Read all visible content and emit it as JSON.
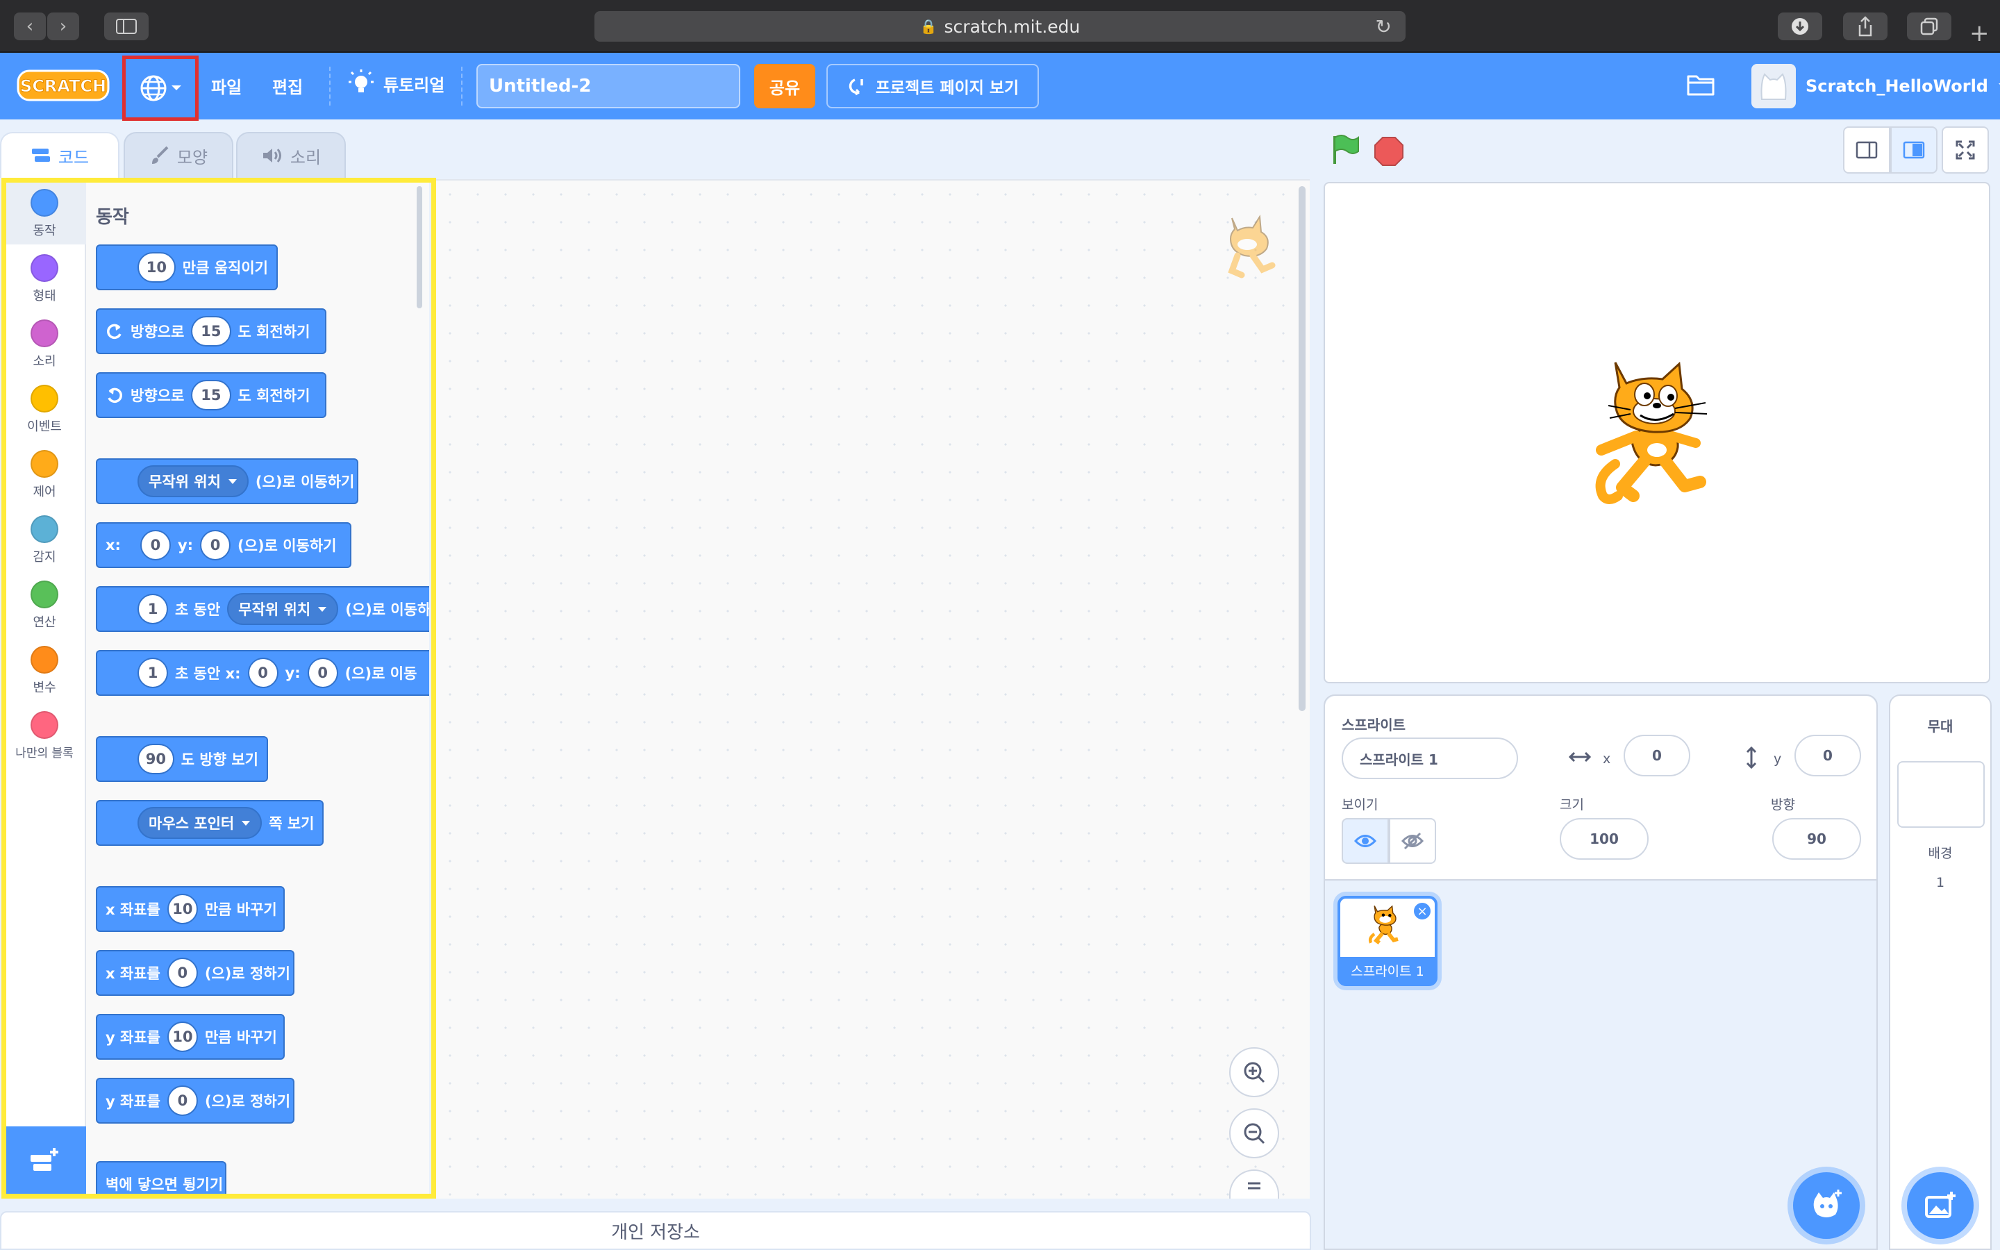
{
  "browser": {
    "url": "scratch.mit.edu"
  },
  "menubar": {
    "file": "파일",
    "edit": "편집",
    "tutorials": "튜토리얼",
    "project_title": "Untitled-2",
    "share": "공유",
    "see_project_page": "프로젝트 페이지 보기",
    "username": "Scratch_HelloWorld",
    "logo_text": "SCRATCH"
  },
  "tabs": {
    "code": "코드",
    "costumes": "모양",
    "sounds": "소리"
  },
  "categories": [
    {
      "label": "동작",
      "color": "#4c97ff"
    },
    {
      "label": "형태",
      "color": "#9966ff"
    },
    {
      "label": "소리",
      "color": "#cf63cf"
    },
    {
      "label": "이벤트",
      "color": "#ffbf00"
    },
    {
      "label": "제어",
      "color": "#ffab19"
    },
    {
      "label": "감지",
      "color": "#5cb1d6"
    },
    {
      "label": "연산",
      "color": "#59c059"
    },
    {
      "label": "변수",
      "color": "#ff8c1a"
    },
    {
      "label": "나만의 블록",
      "color": "#ff6680"
    }
  ],
  "palette": {
    "section_title": "동작",
    "blocks": {
      "move": {
        "value": "10",
        "text": "만큼 움직이기"
      },
      "turn_right": {
        "pre": "방향으로",
        "value": "15",
        "text": "도 회전하기"
      },
      "turn_left": {
        "pre": "방향으로",
        "value": "15",
        "text": "도 회전하기"
      },
      "goto": {
        "dropdown": "무작위 위치",
        "text": "(으)로 이동하기"
      },
      "goto_xy": {
        "x_label": "x:",
        "x": "0",
        "y_label": "y:",
        "y": "0",
        "text": "(으)로 이동하기"
      },
      "glide": {
        "value": "1",
        "mid": "초 동안",
        "dropdown": "무작위 위치",
        "text": "(으)로 이동하"
      },
      "glide_xy": {
        "value": "1",
        "mid": "초 동안 x:",
        "x": "0",
        "y_label": "y:",
        "y": "0",
        "text": "(으)로 이동"
      },
      "point_dir": {
        "value": "90",
        "text": "도 방향 보기"
      },
      "point_towards": {
        "dropdown": "마우스 포인터",
        "text": "쪽 보기"
      },
      "change_x": {
        "pre": "x 좌표를",
        "value": "10",
        "text": "만큼 바꾸기"
      },
      "set_x": {
        "pre": "x 좌표를",
        "value": "0",
        "text": "(으)로 정하기"
      },
      "change_y": {
        "pre": "y 좌표를",
        "value": "10",
        "text": "만큼 바꾸기"
      },
      "set_y": {
        "pre": "y 좌표를",
        "value": "0",
        "text": "(으)로 정하기"
      },
      "bounce": {
        "text": "벽에 닿으면 튕기기"
      }
    }
  },
  "backpack": {
    "label": "개인 저장소"
  },
  "sprite_info": {
    "sprite_label": "스프라이트",
    "sprite_name": "스프라이트 1",
    "x_label": "x",
    "x": "0",
    "y_label": "y",
    "y": "0",
    "show_label": "보이기",
    "size_label": "크기",
    "size": "100",
    "direction_label": "방향",
    "direction": "90"
  },
  "sprite_list": [
    {
      "name": "스프라이트 1"
    }
  ],
  "backdrop": {
    "stage_label": "무대",
    "backdrops_label": "배경",
    "count": "1"
  }
}
